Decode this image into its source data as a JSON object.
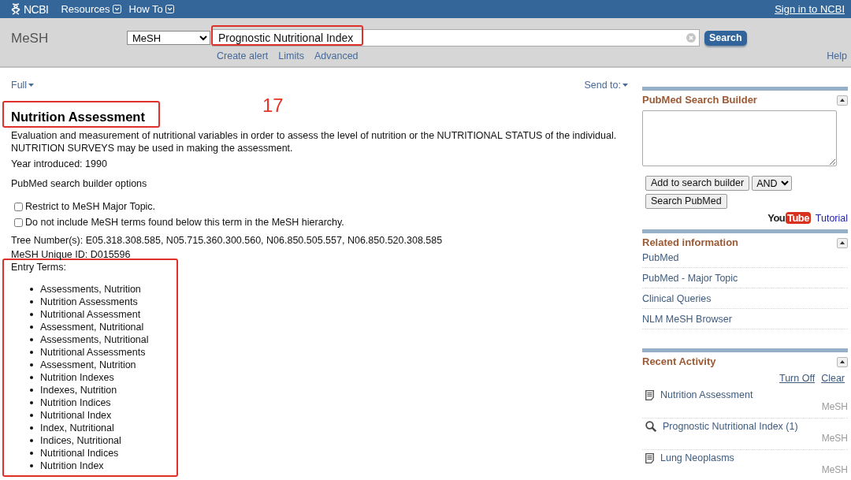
{
  "header": {
    "logo": "NCBI",
    "menus": [
      {
        "label": "Resources"
      },
      {
        "label": "How To"
      }
    ],
    "sign_in": "Sign in to NCBI"
  },
  "search_bar": {
    "database_label": "MeSH",
    "database_select": "MeSH",
    "query": "Prognostic Nutritional Index",
    "query_highlighted": true,
    "search_button": "Search",
    "links": [
      "Create alert",
      "Limits",
      "Advanced"
    ],
    "help": "Help"
  },
  "record": {
    "format_menu": "Full",
    "send_to": "Send to:",
    "title": "Nutrition Assessment",
    "title_highlighted": true,
    "annotation_label": "17",
    "description": "Evaluation and measurement of nutritional variables in order to assess the level of nutrition or the NUTRITIONAL STATUS of the individual. NUTRITION SURVEYS may be used in making the assessment.",
    "year_introduced": "Year introduced: 1990",
    "builder_options_title": "PubMed search builder options",
    "options": [
      {
        "label": "Restrict to MeSH Major Topic.",
        "checked": false
      },
      {
        "label": "Do not include MeSH terms found below this term in the MeSH hierarchy.",
        "checked": false
      }
    ],
    "tree_numbers": "Tree Number(s): E05.318.308.585, N05.715.360.300.560, N06.850.505.557, N06.850.520.308.585",
    "unique_id": "MeSH Unique ID: D015596",
    "entry_terms": {
      "label": "Entry Terms:",
      "highlighted": true,
      "items": [
        "Assessments, Nutrition",
        "Nutrition Assessments",
        "Nutritional Assessment",
        "Assessment, Nutritional",
        "Assessments, Nutritional",
        "Nutritional Assessments",
        "Assessment, Nutrition",
        "Nutrition Indexes",
        "Indexes, Nutrition",
        "Nutrition Indices",
        "Nutritional Index",
        "Index, Nutritional",
        "Indices, Nutritional",
        "Nutritional Indices",
        "Nutrition Index"
      ]
    }
  },
  "sidebar": {
    "search_builder": {
      "title": "PubMed Search Builder",
      "add_button": "Add to search builder",
      "operator": "AND",
      "search_button": "Search PubMed",
      "video_logo": [
        "You",
        "Tube"
      ],
      "tutorial_link": "Tutorial"
    },
    "related_information": {
      "title": "Related information",
      "links": [
        "PubMed",
        "PubMed - Major Topic",
        "Clinical Queries",
        "NLM MeSH Browser"
      ]
    },
    "recent_activity": {
      "title": "Recent Activity",
      "actions": [
        "Turn Off",
        "Clear"
      ],
      "items": [
        {
          "kind": "record",
          "label": "Nutrition Assessment",
          "database": "MeSH"
        },
        {
          "kind": "search",
          "label": "Prognostic Nutritional Index (1)",
          "database": "MeSH"
        },
        {
          "kind": "record",
          "label": "Lung Neoplasms",
          "database": "MeSH"
        }
      ]
    }
  }
}
